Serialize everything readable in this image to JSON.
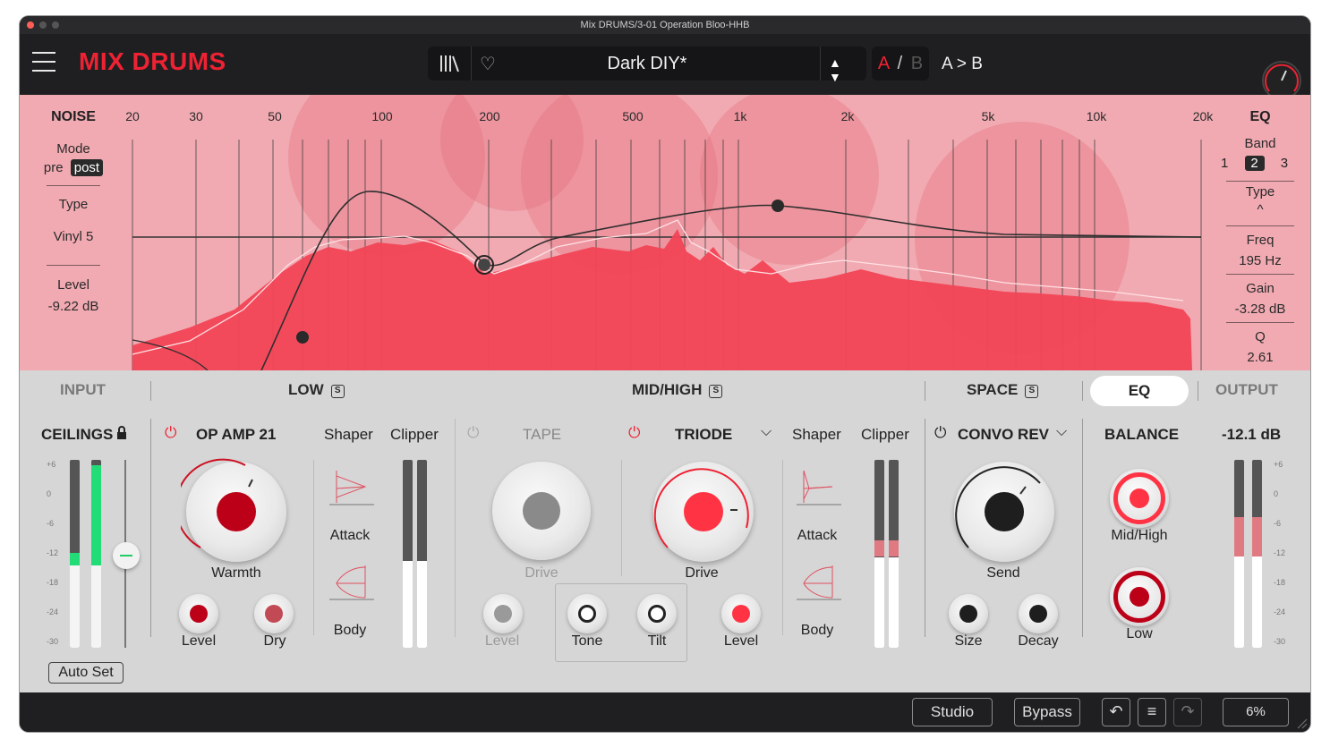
{
  "window": {
    "title": "Mix DRUMS/3-01 Operation Bloo-HHB"
  },
  "header": {
    "app_name": "MIX DRUMS",
    "preset_name": "Dark DIY*",
    "preset_nav": "▲ ▼",
    "ab_a": "A",
    "ab_sep": "/",
    "ab_b": "B",
    "ab_copy": "A > B"
  },
  "noise": {
    "title": "NOISE",
    "mode_label": "Mode",
    "mode_pre": "pre",
    "mode_post": "post",
    "type_label": "Type",
    "type_value": "Vinyl 5",
    "level_label": "Level",
    "level_value": "-9.22 dB"
  },
  "freq_scale": [
    "20",
    "30",
    "50",
    "100",
    "200",
    "500",
    "1k",
    "2k",
    "5k",
    "10k",
    "20k"
  ],
  "eq": {
    "title": "EQ",
    "band_label": "Band",
    "bands": [
      "1",
      "2",
      "3"
    ],
    "selected_band": "2",
    "type_label": "Type",
    "type_icon": "^",
    "freq_label": "Freq",
    "freq_value": "195 Hz",
    "gain_label": "Gain",
    "gain_value": "-3.28 dB",
    "q_label": "Q",
    "q_value": "2.61"
  },
  "tabs": {
    "input": "INPUT",
    "low": "LOW",
    "midhigh": "MID/HIGH",
    "space": "SPACE",
    "eq": "EQ",
    "output": "OUTPUT",
    "solo": "S"
  },
  "input": {
    "title": "CEILINGS",
    "db_scale": [
      "+6",
      "0",
      "-6",
      "-12",
      "-18",
      "-24",
      "-30"
    ],
    "auto_set": "Auto Set"
  },
  "low": {
    "module": "OP AMP 21",
    "shaper": "Shaper",
    "clipper": "Clipper",
    "warmth": "Warmth",
    "level": "Level",
    "dry": "Dry",
    "attack": "Attack",
    "body": "Body"
  },
  "midhigh": {
    "tape": "TAPE",
    "tape_drive": "Drive",
    "tape_level": "Level",
    "tone": "Tone",
    "tilt": "Tilt",
    "module": "TRIODE",
    "drive": "Drive",
    "level": "Level",
    "shaper": "Shaper",
    "clipper": "Clipper",
    "attack": "Attack",
    "body": "Body"
  },
  "space": {
    "module": "CONVO REV",
    "send": "Send",
    "size": "Size",
    "decay": "Decay"
  },
  "balance": {
    "title": "BALANCE",
    "midhigh": "Mid/High",
    "low": "Low"
  },
  "output": {
    "value": "-12.1 dB",
    "db_scale": [
      "+6",
      "0",
      "-6",
      "-12",
      "-18",
      "-24",
      "-30"
    ]
  },
  "footer": {
    "studio": "Studio",
    "bypass": "Bypass",
    "zoom": "6%"
  },
  "colors": {
    "accent": "#ee2233",
    "analyzer_bg": "#f1aab2",
    "spectrum": "#f24456",
    "meter_green": "#22dd77"
  }
}
